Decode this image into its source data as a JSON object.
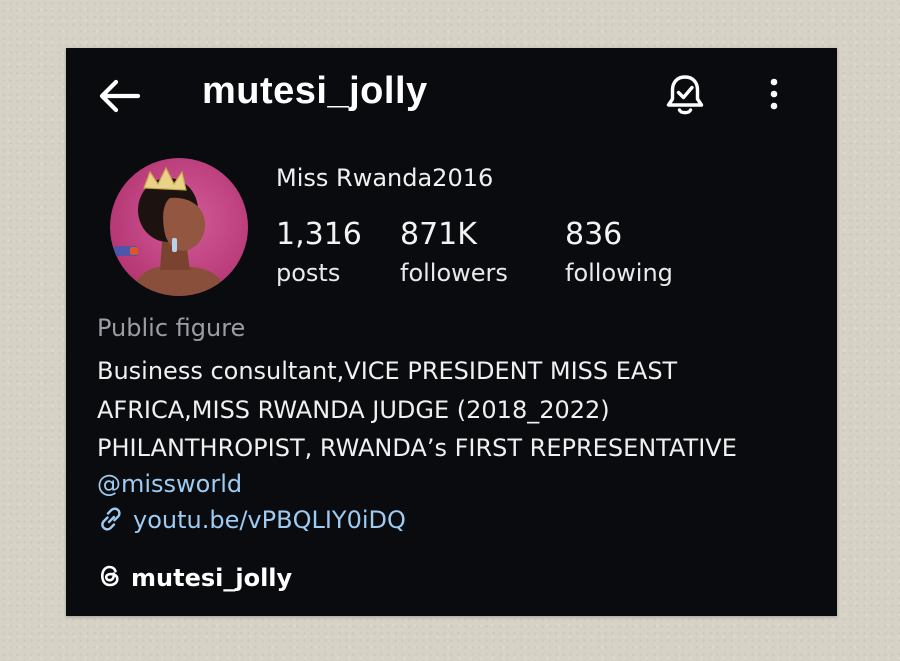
{
  "header": {
    "username": "mutesi_jolly",
    "icons": [
      "back-arrow-icon",
      "notification-bell-icon",
      "more-options-icon"
    ]
  },
  "profile": {
    "display_name": "Miss Rwanda2016",
    "avatar_colors": {
      "background": "#c14a86",
      "ring": "#b9326f"
    },
    "stats": {
      "posts": {
        "value": "1,316",
        "label": "posts"
      },
      "followers": {
        "value": "871K",
        "label": "followers"
      },
      "following": {
        "value": "836",
        "label": "following"
      }
    },
    "category": "Public figure",
    "bio_lines": [
      "Business consultant,VICE PRESIDENT MISS EAST",
      "AFRICA,MISS RWANDA JUDGE (2018_2022)",
      "PHILANTHROPIST, RWANDA’s FIRST REPRESENTATIVE"
    ],
    "mention": "@missworld",
    "link": "youtu.be/vPBQLIY0iDQ",
    "threads_handle": "mutesi_jolly"
  },
  "colors": {
    "screen_background": "#0a0b0e",
    "link_blue": "#9ecbf2",
    "secondary_text": "#9a9da3",
    "page_background": "#d6d2c6"
  }
}
